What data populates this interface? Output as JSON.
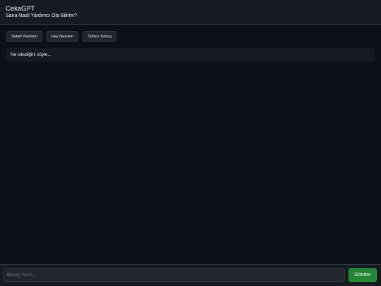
{
  "header": {
    "title": "CekaGPT",
    "subtitle": "Sana Nasil Yardımcı Ola Bilirim?"
  },
  "suggestions": [
    {
      "label": "Selam Nasılsın"
    },
    {
      "label": "Hey Nasılsın"
    },
    {
      "label": "Türkce Konuş"
    }
  ],
  "chat": {
    "prompt": "Ne istediğini söyle..."
  },
  "composer": {
    "placeholder": "Birşey Yazın...",
    "send_label": "Gönder"
  },
  "colors": {
    "background": "#0d1117",
    "panel": "#161b22",
    "send_button": "#238636"
  }
}
